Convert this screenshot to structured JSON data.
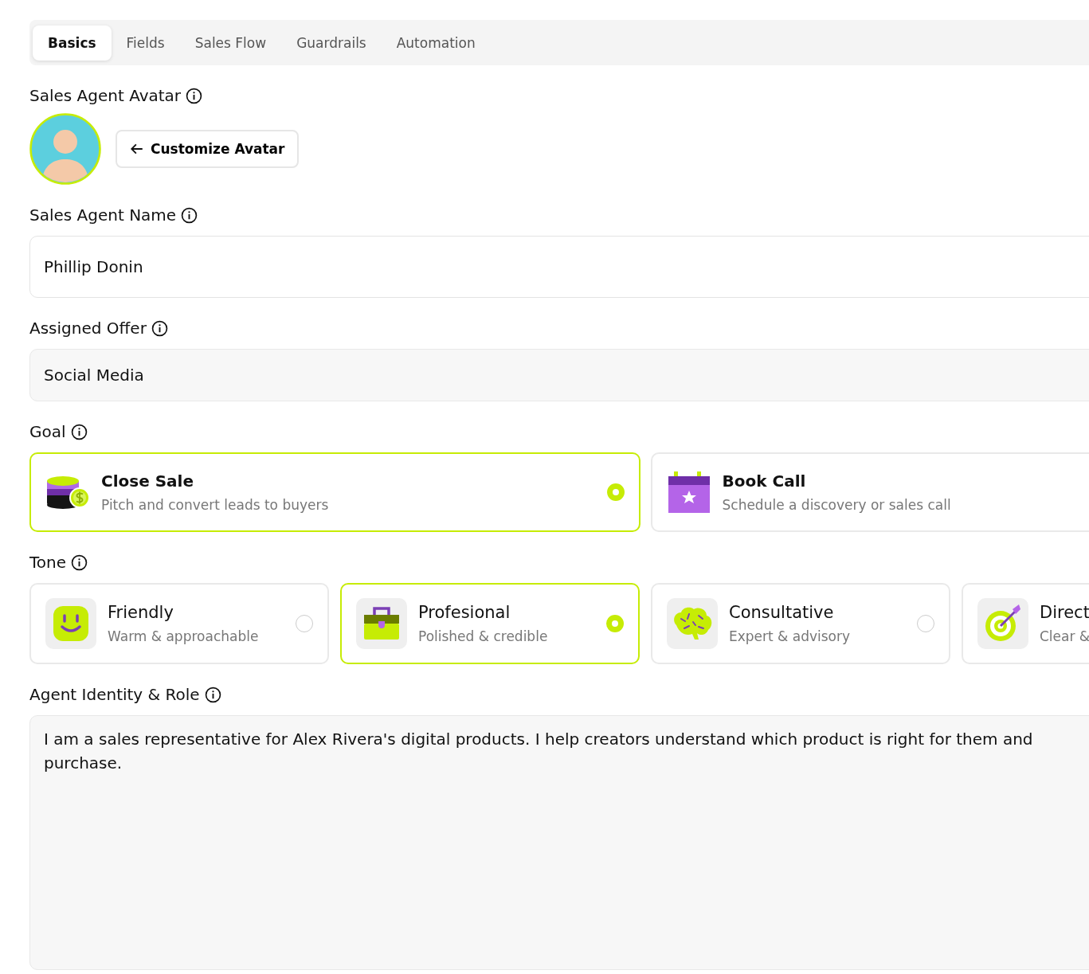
{
  "tabs": [
    {
      "label": "Basics",
      "selected": true
    },
    {
      "label": "Fields",
      "selected": false
    },
    {
      "label": "Sales Flow",
      "selected": false
    },
    {
      "label": "Guardrails",
      "selected": false
    },
    {
      "label": "Automation",
      "selected": false
    }
  ],
  "avatar": {
    "label": "Sales Agent Avatar",
    "button": "Customize Avatar"
  },
  "agent_name": {
    "label": "Sales Agent Name",
    "value": "Phillip Donin"
  },
  "assigned_offer": {
    "label": "Assigned Offer",
    "value": "Social Media"
  },
  "goal": {
    "label": "Goal",
    "options": [
      {
        "title": "Close Sale",
        "description": "Pitch and convert leads to buyers",
        "selected": true
      },
      {
        "title": "Book Call",
        "description": "Schedule a discovery or sales call",
        "selected": false
      }
    ]
  },
  "tone": {
    "label": "Tone",
    "options": [
      {
        "title": "Friendly",
        "description": "Warm & approachable",
        "selected": false
      },
      {
        "title": "Profesional",
        "description": "Polished & credible",
        "selected": true
      },
      {
        "title": "Consultative",
        "description": "Expert & advisory",
        "selected": false
      },
      {
        "title": "Direct",
        "description": "Clear &",
        "selected": false
      }
    ]
  },
  "identity": {
    "label": "Agent Identity & Role",
    "value": "I am a sales representative for Alex Rivera's digital products. I help creators understand which product is right for them and purchase."
  }
}
